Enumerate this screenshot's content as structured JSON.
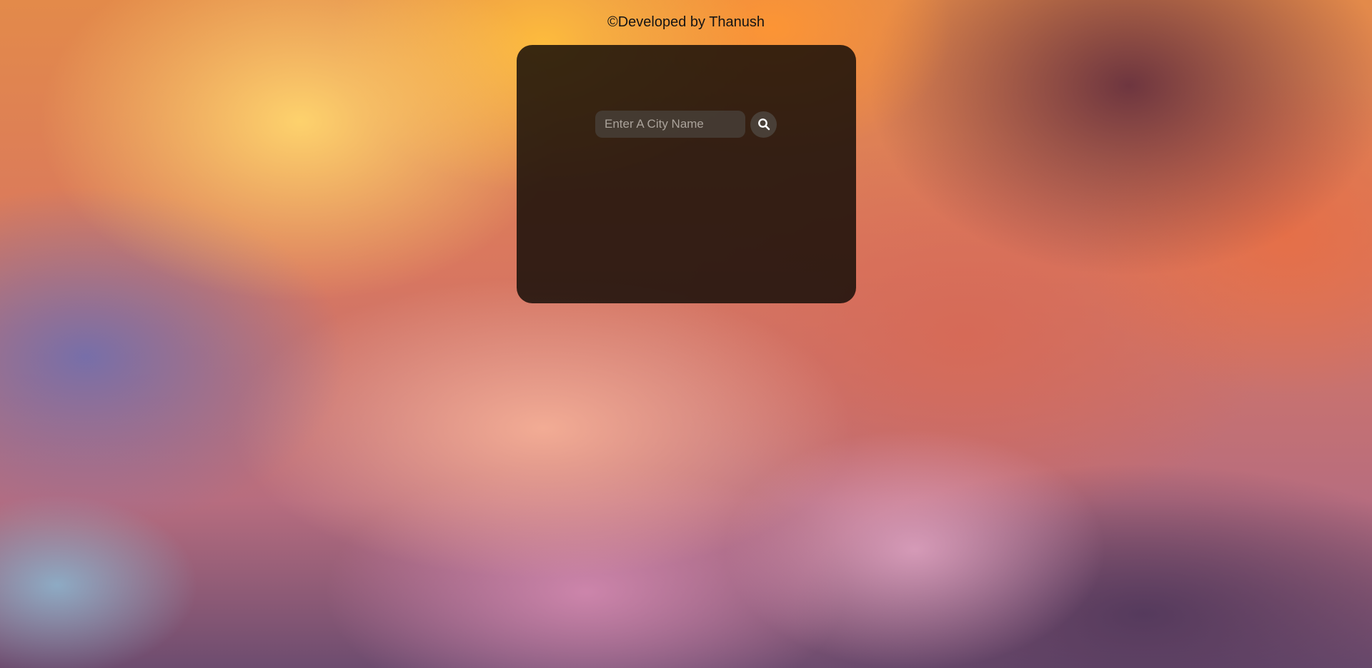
{
  "footer": {
    "credit": "©Developed by Thanush"
  },
  "search": {
    "placeholder": "Enter A City Name",
    "value": "",
    "button_icon": "search-icon"
  },
  "colors": {
    "card_background": "#160e08",
    "input_background": "#463e37",
    "icon_color": "#ffffff",
    "credit_text": "#141414"
  }
}
